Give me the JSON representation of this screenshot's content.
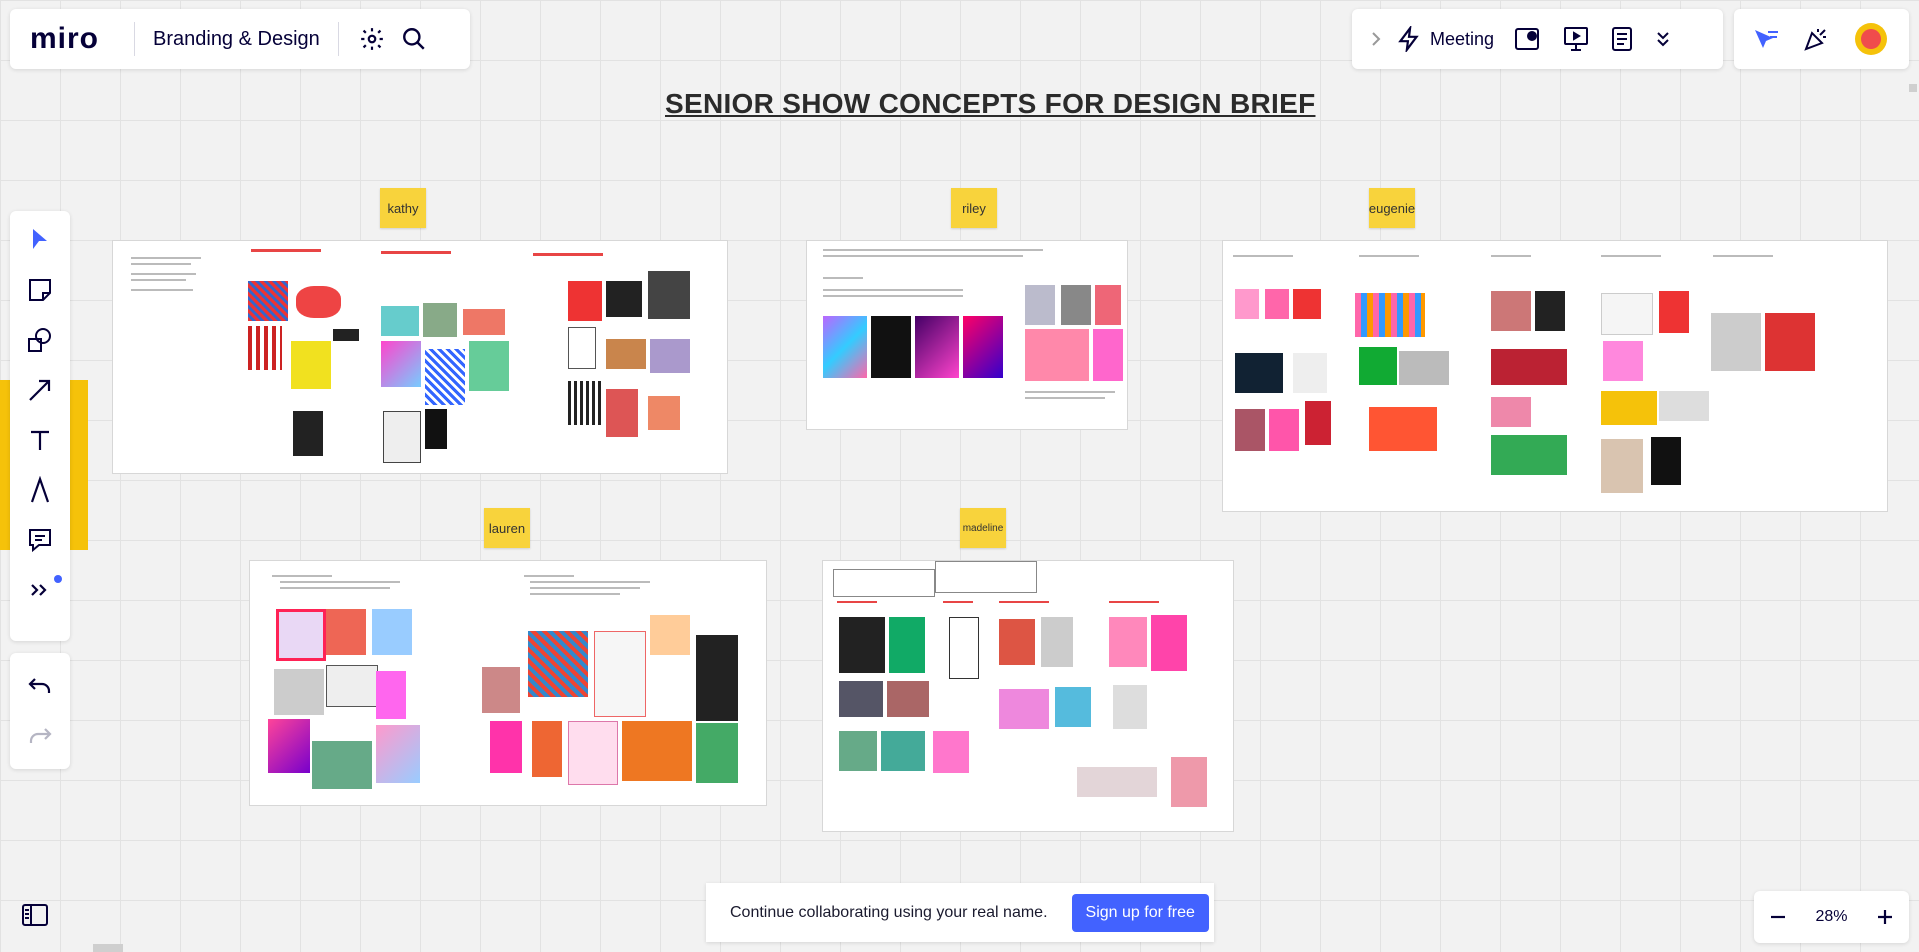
{
  "app": {
    "logo_text": "miro",
    "board_title": "Branding & Design"
  },
  "topbar_right": {
    "meeting_label": "Meeting"
  },
  "board": {
    "heading": "SENIOR SHOW CONCEPTS FOR DESIGN BRIEF",
    "stickies": [
      "kathy",
      "riley",
      "eugenie",
      "lauren",
      "madeline"
    ]
  },
  "notice": {
    "text": "Continue collaborating using your real name.",
    "signup_label": "Sign up for free"
  },
  "zoom": {
    "level": "28%"
  },
  "colors": {
    "accent": "#4262ff",
    "sticky": "#f8d33c"
  },
  "icons": [
    "settings-icon",
    "search-icon",
    "chevron-right-icon",
    "lightning-icon",
    "interactive-icon",
    "presentation-icon",
    "notes-icon",
    "double-chevron-down-icon",
    "cursor-flag-icon",
    "confetti-icon",
    "avatar",
    "select-icon",
    "sticky-note-icon",
    "shapes-icon",
    "arrow-icon",
    "text-icon",
    "pen-icon",
    "comment-icon",
    "more-tools-icon",
    "undo-icon",
    "redo-icon",
    "sidebar-icon",
    "zoom-out-icon",
    "zoom-in-icon"
  ]
}
